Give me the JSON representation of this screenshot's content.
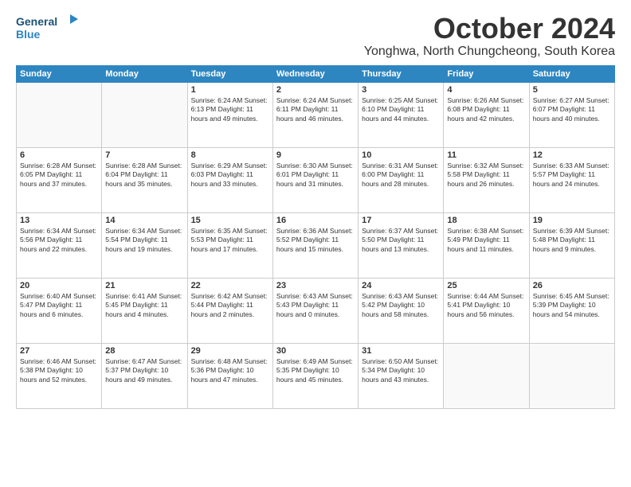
{
  "header": {
    "logo_general": "General",
    "logo_blue": "Blue",
    "month": "October 2024",
    "location": "Yonghwa, North Chungcheong, South Korea"
  },
  "days_of_week": [
    "Sunday",
    "Monday",
    "Tuesday",
    "Wednesday",
    "Thursday",
    "Friday",
    "Saturday"
  ],
  "weeks": [
    [
      {
        "day": "",
        "info": ""
      },
      {
        "day": "",
        "info": ""
      },
      {
        "day": "1",
        "info": "Sunrise: 6:24 AM\nSunset: 6:13 PM\nDaylight: 11 hours and 49 minutes."
      },
      {
        "day": "2",
        "info": "Sunrise: 6:24 AM\nSunset: 6:11 PM\nDaylight: 11 hours and 46 minutes."
      },
      {
        "day": "3",
        "info": "Sunrise: 6:25 AM\nSunset: 6:10 PM\nDaylight: 11 hours and 44 minutes."
      },
      {
        "day": "4",
        "info": "Sunrise: 6:26 AM\nSunset: 6:08 PM\nDaylight: 11 hours and 42 minutes."
      },
      {
        "day": "5",
        "info": "Sunrise: 6:27 AM\nSunset: 6:07 PM\nDaylight: 11 hours and 40 minutes."
      }
    ],
    [
      {
        "day": "6",
        "info": "Sunrise: 6:28 AM\nSunset: 6:05 PM\nDaylight: 11 hours and 37 minutes."
      },
      {
        "day": "7",
        "info": "Sunrise: 6:28 AM\nSunset: 6:04 PM\nDaylight: 11 hours and 35 minutes."
      },
      {
        "day": "8",
        "info": "Sunrise: 6:29 AM\nSunset: 6:03 PM\nDaylight: 11 hours and 33 minutes."
      },
      {
        "day": "9",
        "info": "Sunrise: 6:30 AM\nSunset: 6:01 PM\nDaylight: 11 hours and 31 minutes."
      },
      {
        "day": "10",
        "info": "Sunrise: 6:31 AM\nSunset: 6:00 PM\nDaylight: 11 hours and 28 minutes."
      },
      {
        "day": "11",
        "info": "Sunrise: 6:32 AM\nSunset: 5:58 PM\nDaylight: 11 hours and 26 minutes."
      },
      {
        "day": "12",
        "info": "Sunrise: 6:33 AM\nSunset: 5:57 PM\nDaylight: 11 hours and 24 minutes."
      }
    ],
    [
      {
        "day": "13",
        "info": "Sunrise: 6:34 AM\nSunset: 5:56 PM\nDaylight: 11 hours and 22 minutes."
      },
      {
        "day": "14",
        "info": "Sunrise: 6:34 AM\nSunset: 5:54 PM\nDaylight: 11 hours and 19 minutes."
      },
      {
        "day": "15",
        "info": "Sunrise: 6:35 AM\nSunset: 5:53 PM\nDaylight: 11 hours and 17 minutes."
      },
      {
        "day": "16",
        "info": "Sunrise: 6:36 AM\nSunset: 5:52 PM\nDaylight: 11 hours and 15 minutes."
      },
      {
        "day": "17",
        "info": "Sunrise: 6:37 AM\nSunset: 5:50 PM\nDaylight: 11 hours and 13 minutes."
      },
      {
        "day": "18",
        "info": "Sunrise: 6:38 AM\nSunset: 5:49 PM\nDaylight: 11 hours and 11 minutes."
      },
      {
        "day": "19",
        "info": "Sunrise: 6:39 AM\nSunset: 5:48 PM\nDaylight: 11 hours and 9 minutes."
      }
    ],
    [
      {
        "day": "20",
        "info": "Sunrise: 6:40 AM\nSunset: 5:47 PM\nDaylight: 11 hours and 6 minutes."
      },
      {
        "day": "21",
        "info": "Sunrise: 6:41 AM\nSunset: 5:45 PM\nDaylight: 11 hours and 4 minutes."
      },
      {
        "day": "22",
        "info": "Sunrise: 6:42 AM\nSunset: 5:44 PM\nDaylight: 11 hours and 2 minutes."
      },
      {
        "day": "23",
        "info": "Sunrise: 6:43 AM\nSunset: 5:43 PM\nDaylight: 11 hours and 0 minutes."
      },
      {
        "day": "24",
        "info": "Sunrise: 6:43 AM\nSunset: 5:42 PM\nDaylight: 10 hours and 58 minutes."
      },
      {
        "day": "25",
        "info": "Sunrise: 6:44 AM\nSunset: 5:41 PM\nDaylight: 10 hours and 56 minutes."
      },
      {
        "day": "26",
        "info": "Sunrise: 6:45 AM\nSunset: 5:39 PM\nDaylight: 10 hours and 54 minutes."
      }
    ],
    [
      {
        "day": "27",
        "info": "Sunrise: 6:46 AM\nSunset: 5:38 PM\nDaylight: 10 hours and 52 minutes."
      },
      {
        "day": "28",
        "info": "Sunrise: 6:47 AM\nSunset: 5:37 PM\nDaylight: 10 hours and 49 minutes."
      },
      {
        "day": "29",
        "info": "Sunrise: 6:48 AM\nSunset: 5:36 PM\nDaylight: 10 hours and 47 minutes."
      },
      {
        "day": "30",
        "info": "Sunrise: 6:49 AM\nSunset: 5:35 PM\nDaylight: 10 hours and 45 minutes."
      },
      {
        "day": "31",
        "info": "Sunrise: 6:50 AM\nSunset: 5:34 PM\nDaylight: 10 hours and 43 minutes."
      },
      {
        "day": "",
        "info": ""
      },
      {
        "day": "",
        "info": ""
      }
    ]
  ]
}
